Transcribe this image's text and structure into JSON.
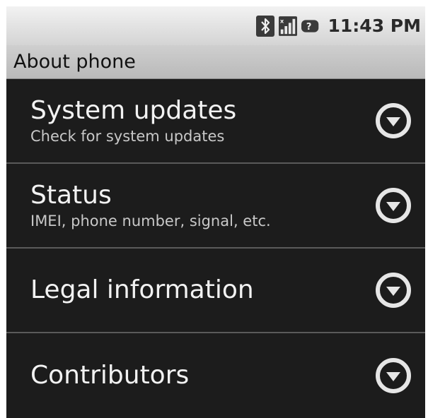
{
  "status_bar": {
    "icons": [
      "bluetooth-icon",
      "signal-icon",
      "battery-unknown-icon"
    ],
    "time": "11:43 PM"
  },
  "title_bar": {
    "title": "About phone"
  },
  "items": [
    {
      "title": "System updates",
      "summary": "Check for system updates",
      "icon": "expand-circle-icon"
    },
    {
      "title": "Status",
      "summary": "IMEI, phone number, signal, etc.",
      "icon": "expand-circle-icon"
    },
    {
      "title": "Legal information",
      "summary": "",
      "icon": "expand-circle-icon"
    },
    {
      "title": "Contributors",
      "summary": "",
      "icon": "expand-circle-icon"
    }
  ],
  "colors": {
    "background": "#1c1c1c",
    "title_bar": "#c4c4c4",
    "status_bar": "#e2e2e2"
  }
}
